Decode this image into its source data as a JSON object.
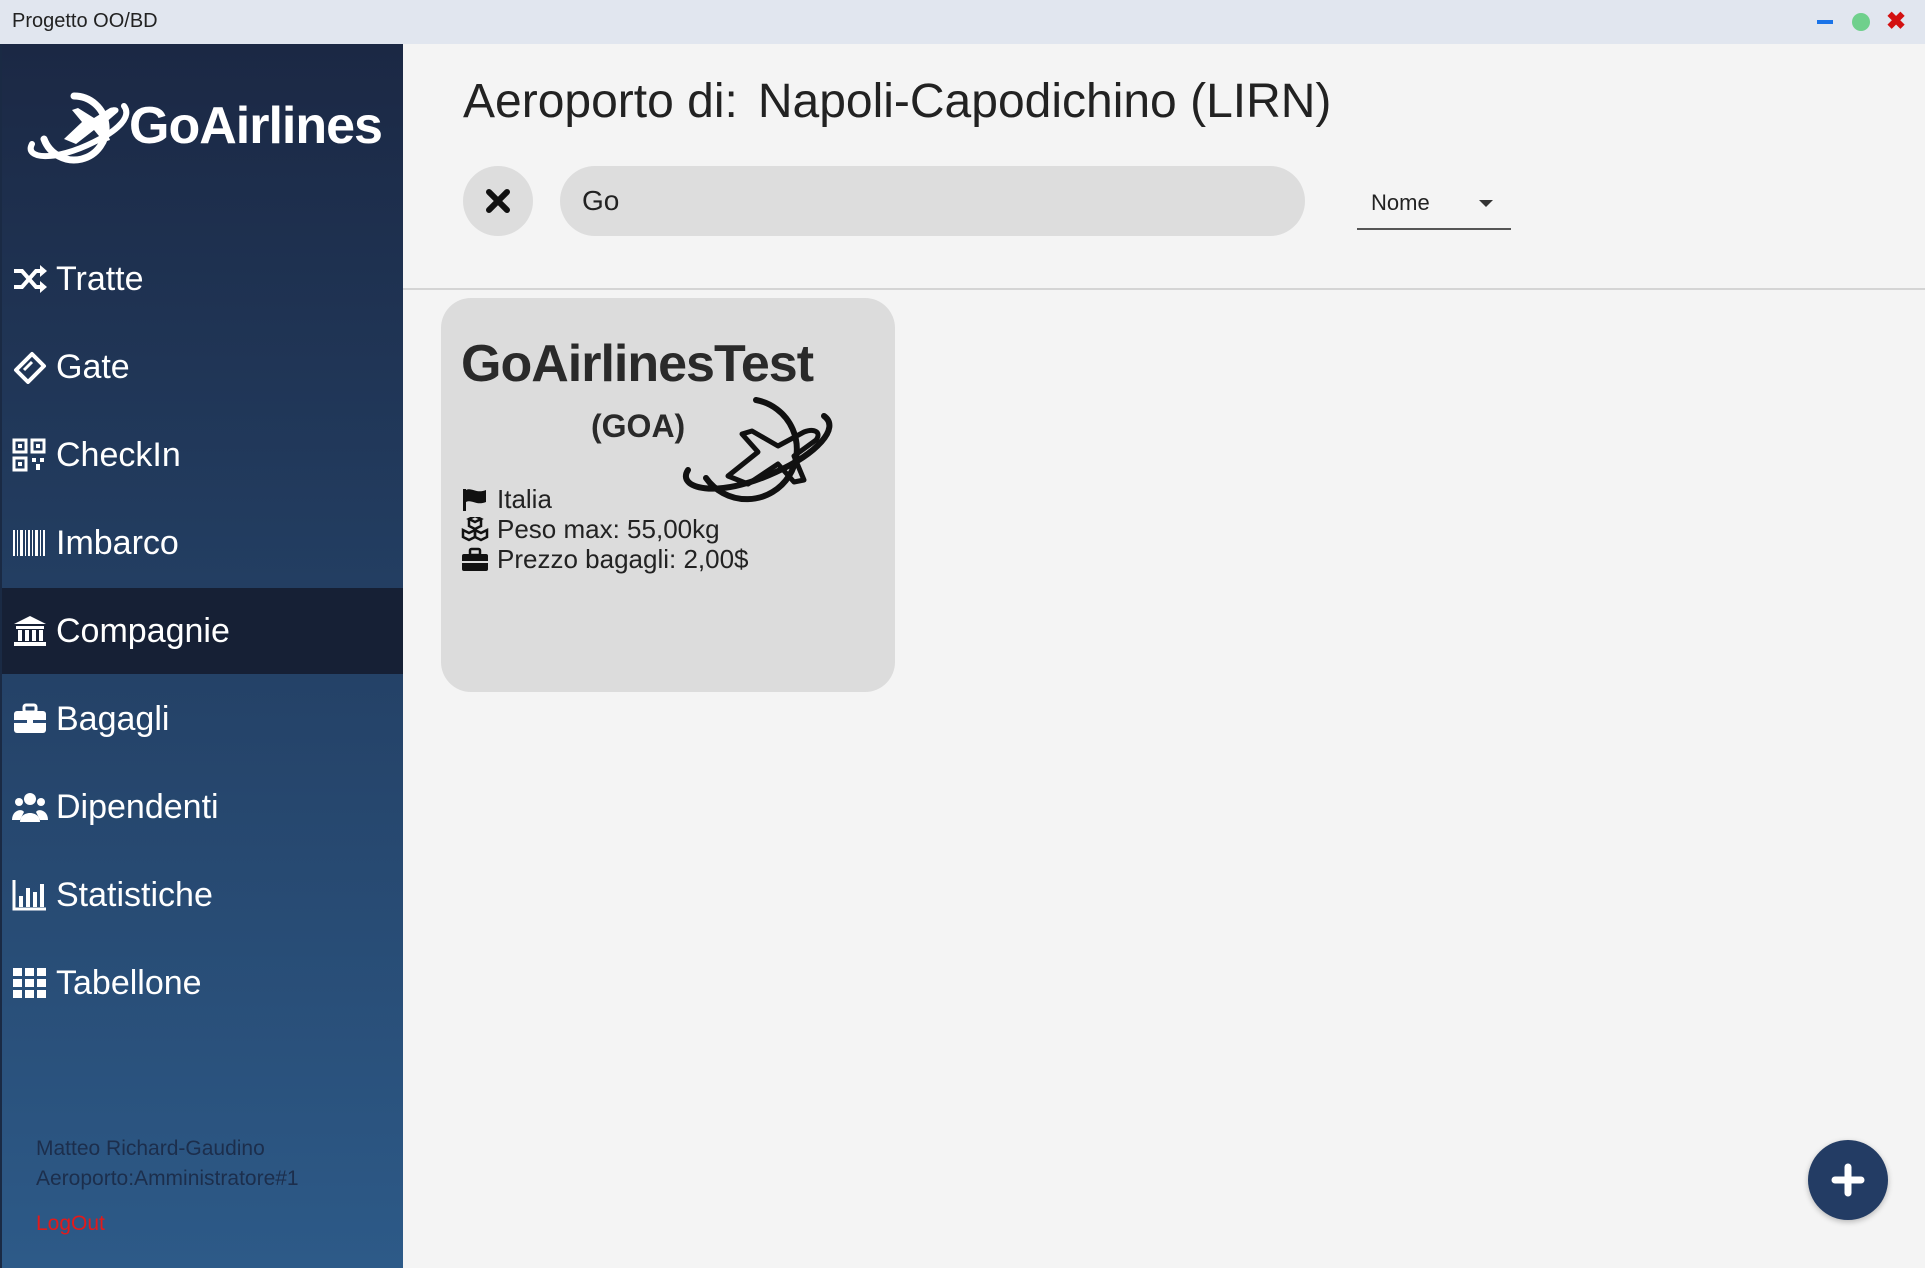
{
  "window": {
    "title": "Progetto OO/BD"
  },
  "brand": {
    "name": "GoAirlines"
  },
  "nav": {
    "items": [
      {
        "label": "Tratte",
        "icon": "shuffle-icon"
      },
      {
        "label": "Gate",
        "icon": "ticket-icon"
      },
      {
        "label": "CheckIn",
        "icon": "qrcode-icon"
      },
      {
        "label": "Imbarco",
        "icon": "barcode-icon"
      },
      {
        "label": "Compagnie",
        "icon": "bank-icon",
        "active": true
      },
      {
        "label": "Bagagli",
        "icon": "suitcase-icon"
      },
      {
        "label": "Dipendenti",
        "icon": "users-icon"
      },
      {
        "label": "Statistiche",
        "icon": "bar-chart-icon"
      },
      {
        "label": "Tabellone",
        "icon": "grid-icon"
      }
    ]
  },
  "user": {
    "name": "Matteo Richard-Gaudino",
    "role": "Aeroporto:Amministratore#1",
    "logout_label": "LogOut"
  },
  "header": {
    "prefix": "Aeroporto di:",
    "airport": "Napoli-Capodichino (LIRN)"
  },
  "search": {
    "value": "Go"
  },
  "sort": {
    "selected": "Nome"
  },
  "companies": [
    {
      "name": "GoAirlinesTest",
      "code": "(GOA)",
      "country": "Italia",
      "weight": "Peso max: 55,00kg",
      "price": "Prezzo bagagli: 2,00$"
    }
  ],
  "colors": {
    "sidebar_top": "#1b2844",
    "sidebar_bottom": "#2d5a88",
    "active_item": "#162035",
    "fab": "#233c64",
    "logout": "#e31a1a"
  }
}
